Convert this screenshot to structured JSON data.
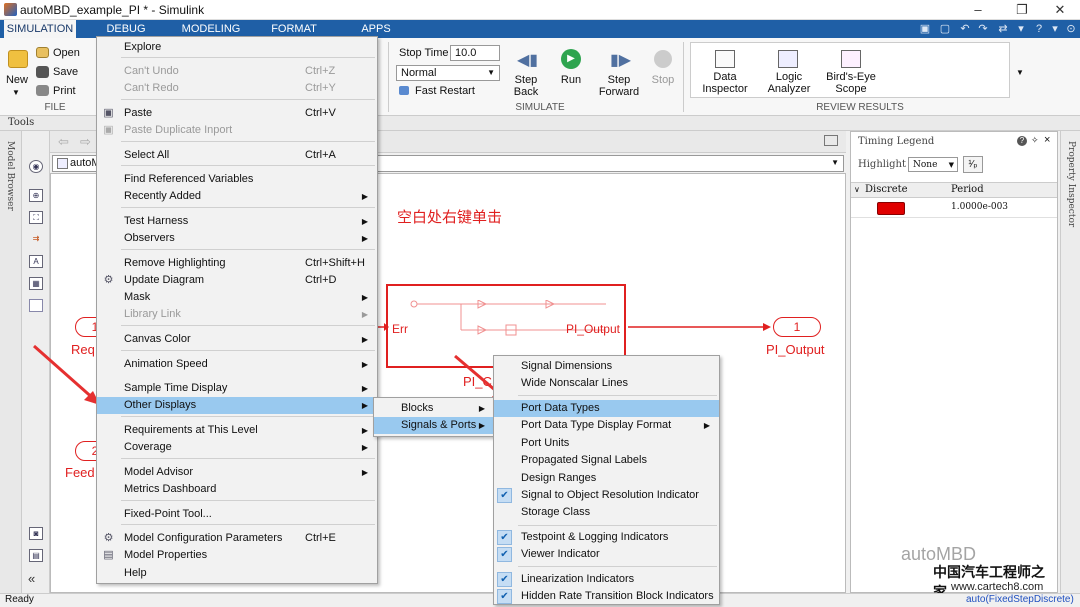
{
  "window": {
    "title": "autoMBD_example_PI * - Simulink",
    "controls": [
      "–",
      "❐",
      "✕"
    ]
  },
  "ribbon_tabs": [
    "SIMULATION",
    "DEBUG",
    "MODELING",
    "FORMAT",
    "APPS"
  ],
  "ribbon": {
    "file": {
      "new_label": "New",
      "open_label": "Open",
      "save_label": "Save",
      "print_label": "Print",
      "group_label": "FILE"
    },
    "simulate": {
      "stop_time_label": "Stop Time",
      "stop_time_value": "10.0",
      "mode_value": "Normal",
      "fast_restart_label": "Fast Restart",
      "step_back_label": "Step Back",
      "run_label": "Run",
      "step_forward_label": "Step Forward",
      "stop_label": "Stop",
      "group_label": "SIMULATE"
    },
    "review": {
      "data_inspector_label": "Data Inspector",
      "logic_analyzer_label": "Logic Analyzer",
      "birds_eye_label": "Bird's-Eye Scope",
      "group_label": "REVIEW RESULTS"
    }
  },
  "tools_label": "Tools",
  "left_strip_label": "Model Browser",
  "address_value": "autoM",
  "canvas": {
    "annotation": "空白处右键单击",
    "subsystem_in": "Err",
    "subsystem_out": "PI_Output",
    "subsystem_name": "PI_C",
    "inport1_num": "1",
    "inport1_label": "Req",
    "inport2_num": "2",
    "inport2_label": "Feed",
    "outport_num": "1",
    "outport_label": "PI_Output"
  },
  "timing_legend": {
    "title": "Timing Legend",
    "highlight_label": "Highlight",
    "highlight_value": "None",
    "col_discrete": "Discrete",
    "col_period": "Period",
    "row_period": "1.0000e-003",
    "row_color": "#e00000"
  },
  "property_inspector_label": "Property Inspector",
  "status": {
    "left": "Ready",
    "right": "auto(FixedStepDiscrete)"
  },
  "context_menu": [
    {
      "label": "Explore",
      "shortcut": "",
      "disabled": false,
      "submenu": false
    },
    {
      "label": "Can't Undo",
      "shortcut": "Ctrl+Z",
      "disabled": true,
      "submenu": false
    },
    {
      "label": "Can't Redo",
      "shortcut": "Ctrl+Y",
      "disabled": true,
      "submenu": false
    },
    {
      "label": "Paste",
      "shortcut": "Ctrl+V",
      "disabled": false,
      "submenu": false
    },
    {
      "label": "Paste Duplicate Inport",
      "shortcut": "",
      "disabled": true,
      "submenu": false
    },
    {
      "label": "Select All",
      "shortcut": "Ctrl+A",
      "disabled": false,
      "submenu": false
    },
    {
      "label": "Find Referenced Variables",
      "shortcut": "",
      "disabled": false,
      "submenu": false
    },
    {
      "label": "Recently Added",
      "shortcut": "",
      "disabled": false,
      "submenu": true
    },
    {
      "label": "Test Harness",
      "shortcut": "",
      "disabled": false,
      "submenu": true
    },
    {
      "label": "Observers",
      "shortcut": "",
      "disabled": false,
      "submenu": true
    },
    {
      "label": "Remove Highlighting",
      "shortcut": "Ctrl+Shift+H",
      "disabled": false,
      "submenu": false
    },
    {
      "label": "Update Diagram",
      "shortcut": "Ctrl+D",
      "disabled": false,
      "submenu": false
    },
    {
      "label": "Mask",
      "shortcut": "",
      "disabled": false,
      "submenu": true
    },
    {
      "label": "Library Link",
      "shortcut": "",
      "disabled": true,
      "submenu": true
    },
    {
      "label": "Canvas Color",
      "shortcut": "",
      "disabled": false,
      "submenu": true
    },
    {
      "label": "Animation Speed",
      "shortcut": "",
      "disabled": false,
      "submenu": true
    },
    {
      "label": "Sample Time Display",
      "shortcut": "",
      "disabled": false,
      "submenu": true
    },
    {
      "label": "Other Displays",
      "shortcut": "",
      "disabled": false,
      "submenu": true
    },
    {
      "label": "Requirements at This Level",
      "shortcut": "",
      "disabled": false,
      "submenu": true
    },
    {
      "label": "Coverage",
      "shortcut": "",
      "disabled": false,
      "submenu": true
    },
    {
      "label": "Model Advisor",
      "shortcut": "",
      "disabled": false,
      "submenu": true
    },
    {
      "label": "Metrics Dashboard",
      "shortcut": "",
      "disabled": false,
      "submenu": false
    },
    {
      "label": "Fixed-Point Tool...",
      "shortcut": "",
      "disabled": false,
      "submenu": false
    },
    {
      "label": "Model Configuration Parameters",
      "shortcut": "Ctrl+E",
      "disabled": false,
      "submenu": false
    },
    {
      "label": "Model Properties",
      "shortcut": "",
      "disabled": false,
      "submenu": false
    },
    {
      "label": "Help",
      "shortcut": "",
      "disabled": false,
      "submenu": false
    }
  ],
  "other_displays_menu": [
    "Blocks",
    "Signals & Ports"
  ],
  "signals_ports_menu": [
    {
      "label": "Signal Dimensions",
      "checked": false,
      "submenu": false
    },
    {
      "label": "Wide Nonscalar Lines",
      "checked": false,
      "submenu": false
    },
    {
      "label": "Port Data Types",
      "checked": false,
      "submenu": false
    },
    {
      "label": "Port Data Type Display Format",
      "checked": false,
      "submenu": true
    },
    {
      "label": "Port Units",
      "checked": false,
      "submenu": false
    },
    {
      "label": "Propagated Signal Labels",
      "checked": false,
      "submenu": false
    },
    {
      "label": "Design Ranges",
      "checked": false,
      "submenu": false
    },
    {
      "label": "Signal to Object Resolution Indicator",
      "checked": true,
      "submenu": false
    },
    {
      "label": "Storage Class",
      "checked": false,
      "submenu": false
    },
    {
      "label": "Testpoint & Logging Indicators",
      "checked": true,
      "submenu": false
    },
    {
      "label": "Viewer Indicator",
      "checked": true,
      "submenu": false
    },
    {
      "label": "Linearization Indicators",
      "checked": true,
      "submenu": false
    },
    {
      "label": "Hidden Rate Transition Block Indicators",
      "checked": true,
      "submenu": false
    }
  ],
  "watermark": {
    "brand": "autoMBD",
    "cn": "中国汽车工程师之家",
    "url": "www.cartech8.com"
  }
}
